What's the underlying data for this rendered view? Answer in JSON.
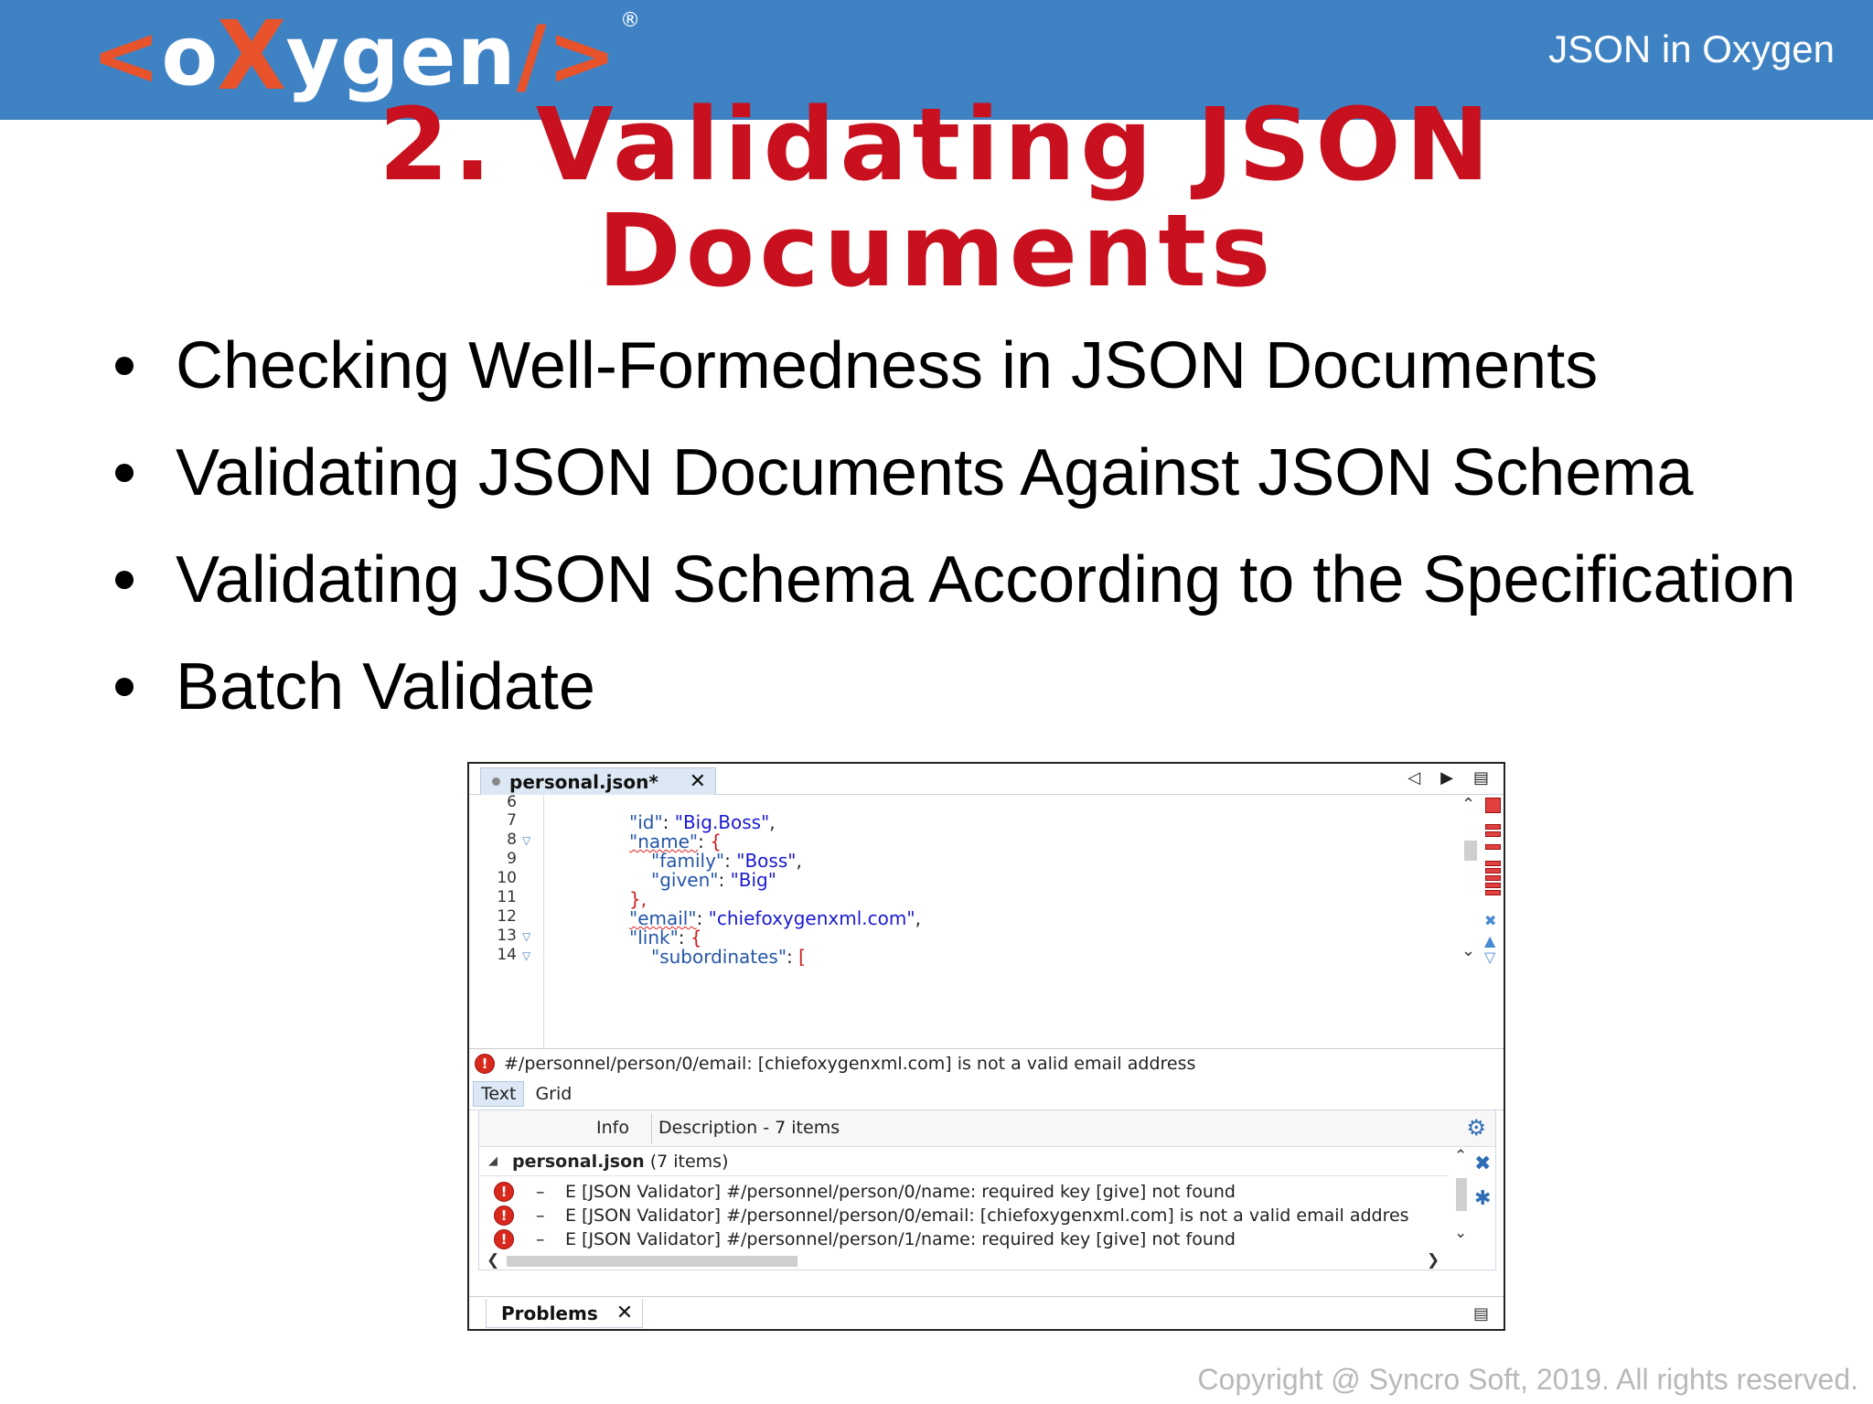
{
  "header": {
    "logo": {
      "lt": "<",
      "o": "o",
      "x": "X",
      "rest": "ygen",
      "slash": "/>",
      "reg": "®"
    },
    "title": "JSON in Oxygen"
  },
  "slide": {
    "title_line1": "2. Validating JSON",
    "title_line2": "Documents",
    "bullets": [
      "Checking Well-Formedness in JSON Documents",
      "Validating JSON Documents Against JSON Schema",
      "Validating JSON Schema According to the Specification",
      "Batch Validate"
    ]
  },
  "ide": {
    "editor_tab": {
      "label": "personal.json*",
      "close": "✕"
    },
    "tab_nav": {
      "prev": "◁",
      "next": "▶",
      "menu": "▤"
    },
    "line_numbers": [
      "6",
      "7",
      "8",
      "9",
      "10",
      "11",
      "12",
      "13",
      "14"
    ],
    "code": {
      "l7_key": "\"id\"",
      "l7_colon": ": ",
      "l7_val": "\"Big.Boss\"",
      "l7_end": ",",
      "l8_key": "\"name\"",
      "l8_colon": ": ",
      "l8_end": "{",
      "l9_key": "\"family\"",
      "l9_colon": ": ",
      "l9_val": "\"Boss\"",
      "l9_end": ",",
      "l10_key": "\"given\"",
      "l10_colon": ": ",
      "l10_val": "\"Big\"",
      "l11": "},",
      "l12_key": "\"email\"",
      "l12_colon": ": ",
      "l12_val": "\"chiefoxygenxml.com\"",
      "l12_end": ",",
      "l13_key": "\"link\"",
      "l13_colon": ": ",
      "l13_end": "{",
      "l14_key": "\"subordinates\"",
      "l14_colon": ": ",
      "l14_end": "["
    },
    "error_message": "#/personnel/person/0/email: [chiefoxygenxml.com] is not a valid email address",
    "mode_tabs": [
      "Text",
      "Grid"
    ],
    "problems": {
      "col_info": "Info",
      "col_description": "Description - 7 items",
      "group_file": "personal.json",
      "group_count": "(7 items)",
      "rows": [
        {
          "dash": "–",
          "text": "E [JSON Validator] #/personnel/person/0/name: required key [give] not found"
        },
        {
          "dash": "–",
          "text": "E [JSON Validator] #/personnel/person/0/email: [chiefoxygenxml.com] is not a valid email addres"
        },
        {
          "dash": "–",
          "text": "E [JSON Validator] #/personnel/person/1/name: required key [give] not found"
        }
      ],
      "tab_label": "Problems",
      "tab_close": "✕"
    }
  },
  "copyright": "Copyright @ Syncro Soft, 2019. All rights reserved.",
  "colors": {
    "header_bg": "#3f82c4",
    "title_red": "#c8101e",
    "logo_orange": "#e8532b",
    "error_red": "#d9291c"
  }
}
